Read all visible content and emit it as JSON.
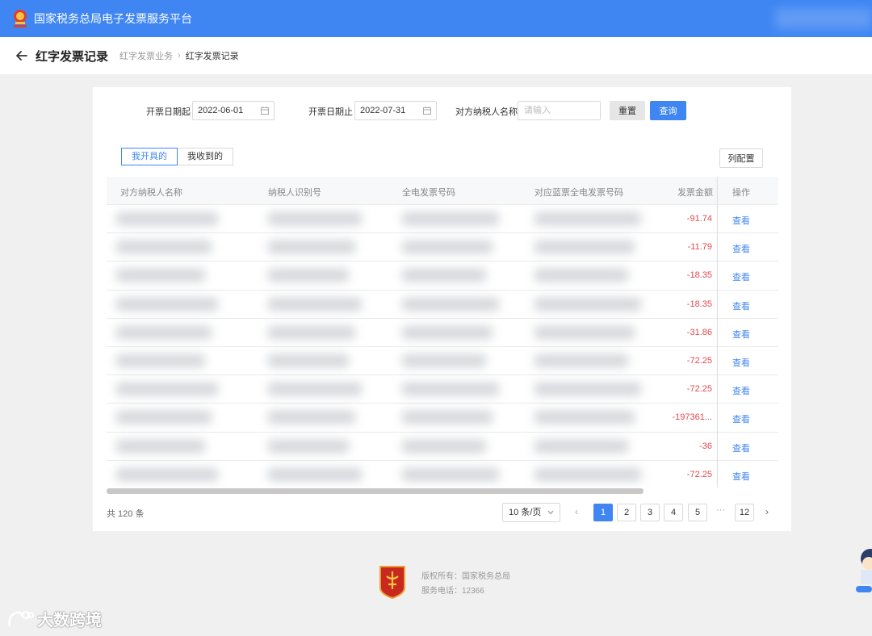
{
  "header": {
    "app_title": "国家税务总局电子发票服务平台"
  },
  "subheader": {
    "title": "红字发票记录",
    "breadcrumb": [
      "红字发票业务",
      "红字发票记录"
    ]
  },
  "filters": {
    "start_label": "开票日期起",
    "start_value": "2022-06-01",
    "end_label": "开票日期止",
    "end_value": "2022-07-31",
    "name_label": "对方纳税人名称",
    "name_placeholder": "请输入",
    "reset_label": "重置",
    "query_label": "查询"
  },
  "tabs": [
    {
      "label": "我开具的",
      "active": true
    },
    {
      "label": "我收到的",
      "active": false
    }
  ],
  "column_config_label": "列配置",
  "table": {
    "columns": [
      "对方纳税人名称",
      "纳税人识别号",
      "全电发票号码",
      "对应蓝票全电发票号码",
      "发票金额",
      "操作"
    ],
    "view_label": "查看",
    "rows": [
      {
        "amount": "-91.74"
      },
      {
        "amount": "-11.79"
      },
      {
        "amount": "-18.35"
      },
      {
        "amount": "-18.35"
      },
      {
        "amount": "-31.86"
      },
      {
        "amount": "-72.25"
      },
      {
        "amount": "-72.25"
      },
      {
        "amount": "-197361..."
      },
      {
        "amount": "-36"
      },
      {
        "amount": "-72.25"
      }
    ]
  },
  "pagination": {
    "total_text": "共 120 条",
    "page_size": "10 条/页",
    "pages": [
      "1",
      "2",
      "3",
      "4",
      "5"
    ],
    "ellipsis": "···",
    "last_page": "12",
    "current": "1"
  },
  "footer": {
    "copyright": "版权所有：国家税务总局",
    "phone": "服务电话：12366"
  },
  "watermark": "大数跨境",
  "colors": {
    "primary": "#3f86f3",
    "negative": "#e5484d"
  }
}
